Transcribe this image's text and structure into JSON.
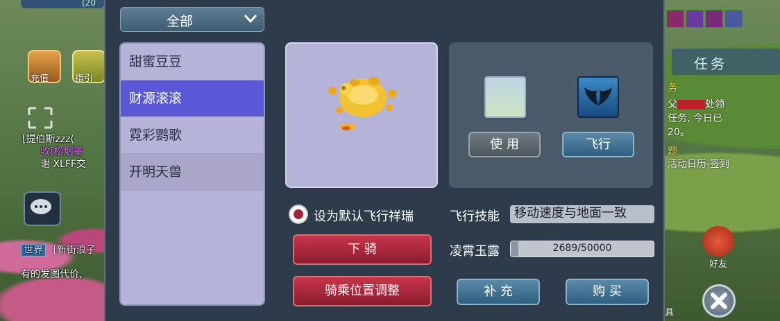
{
  "hud": {
    "top_counter": "(20",
    "recharge_label": "充值",
    "guide_label": "指引",
    "task_tab": "任务",
    "friend_label": "好友",
    "items_label": "具"
  },
  "chat": {
    "line1": "[提伯斯zzz(",
    "line2": "收[松烟墨",
    "line3": "谢 XLFF交",
    "world_tag": "世界",
    "world_line": "[新街浪子",
    "world_line2": "有的发图代价,"
  },
  "quest": {
    "line1": "务",
    "line2_a": "父",
    "line2_b": "处领",
    "line3": "任务, 今日已",
    "line4": "20。",
    "line5": "题",
    "line6": "活动日历-签到"
  },
  "dialog": {
    "filter": {
      "selected": "全部"
    },
    "mounts": [
      {
        "name": "甜蜜豆豆"
      },
      {
        "name": "财源滚滚"
      },
      {
        "name": "霓彩鹦歌"
      },
      {
        "name": "开明天兽"
      }
    ],
    "selected_index": 1,
    "use_button": "使 用",
    "fly_button": "飞行",
    "default_fly_label": "设为默认飞行祥瑞",
    "default_fly_checked": true,
    "dismount_button": "下 骑",
    "ride_adjust_button": "骑乘位置调整",
    "fly_skill_label": "飞行技能",
    "fly_skill_value": "移动速度与地面一致",
    "dew_label": "凌霄玉露",
    "dew_progress": "2689/50000",
    "dew_current": 2689,
    "dew_max": 50000,
    "refill_button": "补 充",
    "buy_button": "购 买"
  },
  "colors": {
    "selected_row": "#5a58d6",
    "list_bg": "#b6b3d8",
    "accent_red": "#a6203a"
  }
}
